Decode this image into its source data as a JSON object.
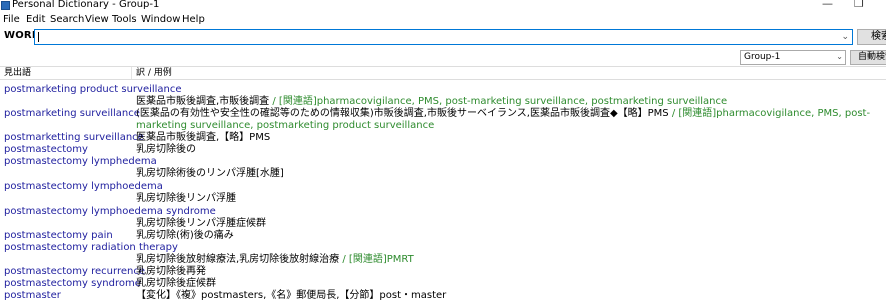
{
  "window": {
    "title": "Personal Dictionary - Group-1",
    "minimize_glyph": "—",
    "restore_glyph": "❐"
  },
  "menu": [
    "File",
    "Edit",
    "Search",
    "View",
    "Tools",
    "Window",
    "Help"
  ],
  "word_bar": {
    "label": "WORD",
    "input_value": "",
    "search_button": "検索"
  },
  "group_bar": {
    "selected_group": "Group-1",
    "auto_button": "自動検索"
  },
  "columns": {
    "headword": "見出語",
    "translation": "訳 / 用例"
  },
  "icons": {
    "app": "book-icon",
    "dropdown": "chevron-down-icon"
  },
  "colors": {
    "headword": "#1e1e9e",
    "related": "#2e8b2e",
    "input_focus": "#0078d7"
  },
  "entries": [
    {
      "headword": "postmarketing product surveillance",
      "translation": "医薬品市販後調査,市販後調査",
      "related": " / [関連語]pharmacovigilance, PMS, post-marketing surveillance, postmarketing surveillance"
    },
    {
      "headword": "postmarketing surveillance",
      "translation": "(医薬品の有効性や安全性の確認等のための情報収集)市販後調査,市販後サーベイランス,医薬品市販後調査◆【略】PMS",
      "related": " / [関連語]pharmacovigilance, PMS, post-marketing surveillance, postmarketing product surveillance"
    },
    {
      "headword": "postmarketting surveillance",
      "translation": "医薬品市販後調査,【略】PMS",
      "related": ""
    },
    {
      "headword": "postmastectomy",
      "translation": "乳房切除後の",
      "related": ""
    },
    {
      "headword": "postmastectomy lymphedema",
      "translation": "乳房切除術後のリンパ浮腫[水腫]",
      "related": ""
    },
    {
      "headword": "postmastectomy lymphoedema",
      "translation": "乳房切除後リンパ浮腫",
      "related": ""
    },
    {
      "headword": "postmastectomy lymphoedema syndrome",
      "translation": "乳房切除後リンパ浮腫症候群",
      "related": ""
    },
    {
      "headword": "postmastectomy pain",
      "translation": "乳房切除(術)後の痛み",
      "related": ""
    },
    {
      "headword": "postmastectomy radiation therapy",
      "translation": "乳房切除後放射線療法,乳房切除後放射線治療",
      "related": " / [関連語]PMRT"
    },
    {
      "headword": "postmastectomy recurrence",
      "translation": "乳房切除後再発",
      "related": ""
    },
    {
      "headword": "postmastectomy syndrome",
      "translation": "乳房切除後症候群",
      "related": ""
    },
    {
      "headword": "postmaster",
      "translation": "【変化】《複》postmasters,《名》郵便局長,【分節】post・master",
      "related": ""
    }
  ]
}
